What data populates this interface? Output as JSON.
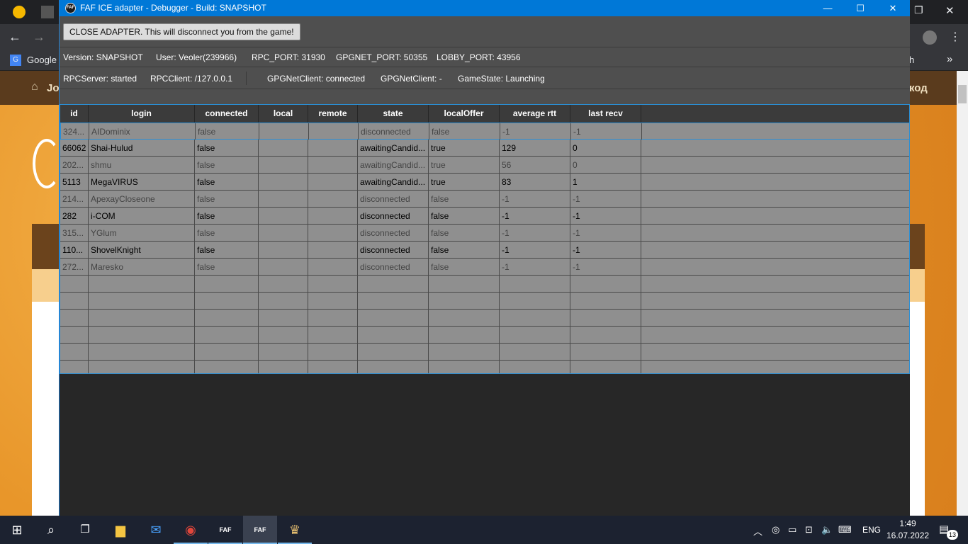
{
  "window": {
    "title": "FAF ICE adapter - Debugger - Build: SNAPSHOT",
    "app_icon_text": "FAF",
    "minimize_glyph": "—",
    "maximize_glyph": "☐",
    "close_glyph": "✕"
  },
  "toolbar": {
    "close_adapter_label": "CLOSE ADAPTER. This will disconnect you from the game!"
  },
  "info": {
    "version": "Version: SNAPSHOT",
    "user": "User: Veoler(239966)",
    "rpc_port": "RPC_PORT: 31930",
    "gpgnet_port": "GPGNET_PORT: 50355",
    "lobby_port": "LOBBY_PORT: 43956"
  },
  "status": {
    "rpc_server": "RPCServer: started",
    "rpc_client": "RPCClient: /127.0.0.1",
    "gpgnet_client": "GPGNetClient: connected",
    "gpgnet_client2": "GPGNetClient: -",
    "game_state": "GameState: Launching"
  },
  "table": {
    "columns": [
      "id",
      "login",
      "connected",
      "local",
      "remote",
      "state",
      "localOffer",
      "average rtt",
      "last recv"
    ],
    "rows": [
      {
        "id": "324...",
        "login": "AIDominix",
        "connected": "false",
        "local": "",
        "remote": "",
        "state": "disconnected",
        "localOffer": "false",
        "rtt": "-1",
        "recv": "-1"
      },
      {
        "id": "66062",
        "login": "Shai-Hulud",
        "connected": "false",
        "local": "",
        "remote": "",
        "state": "awaitingCandid...",
        "localOffer": "true",
        "rtt": "129",
        "recv": "0"
      },
      {
        "id": "202...",
        "login": "shmu",
        "connected": "false",
        "local": "",
        "remote": "",
        "state": "awaitingCandid...",
        "localOffer": "true",
        "rtt": "56",
        "recv": "0"
      },
      {
        "id": "5113",
        "login": "MegaVIRUS",
        "connected": "false",
        "local": "",
        "remote": "",
        "state": "awaitingCandid...",
        "localOffer": "true",
        "rtt": "83",
        "recv": "1"
      },
      {
        "id": "214...",
        "login": "ApexayCloseone",
        "connected": "false",
        "local": "",
        "remote": "",
        "state": "disconnected",
        "localOffer": "false",
        "rtt": "-1",
        "recv": "-1"
      },
      {
        "id": "282",
        "login": "i-COM",
        "connected": "false",
        "local": "",
        "remote": "",
        "state": "disconnected",
        "localOffer": "false",
        "rtt": "-1",
        "recv": "-1"
      },
      {
        "id": "315...",
        "login": "YGlum",
        "connected": "false",
        "local": "",
        "remote": "",
        "state": "disconnected",
        "localOffer": "false",
        "rtt": "-1",
        "recv": "-1"
      },
      {
        "id": "110...",
        "login": "ShovelKnight",
        "connected": "false",
        "local": "",
        "remote": "",
        "state": "disconnected",
        "localOffer": "false",
        "rtt": "-1",
        "recv": "-1"
      },
      {
        "id": "272...",
        "login": "Maresko",
        "connected": "false",
        "local": "",
        "remote": "",
        "state": "disconnected",
        "localOffer": "false",
        "rtt": "-1",
        "recv": "-1"
      }
    ]
  },
  "background": {
    "bookmark_text": "Google I",
    "site_nav_left": "Jo",
    "site_nav_right": "код",
    "bookmark_right": "h"
  },
  "taskbar": {
    "start_icon": "⊞",
    "search_icon": "⌕",
    "taskview_icon": "❐",
    "explorer_icon": "▆",
    "mail_icon": "✉",
    "chrome_icon": "◉",
    "faf1_icon": "FAF",
    "faf2_icon": "FAF",
    "game_icon": "♛",
    "language": "ENG",
    "time": "1:49",
    "date": "16.07.2022",
    "notification_count": "13"
  },
  "colors": {
    "titlebar": "#0078d7",
    "window_bg": "#272727",
    "panel_bg": "#4f4f4f",
    "table_row": "#8f8f8f",
    "table_header": "#3b3b3b",
    "accent_border": "#2a8fd6"
  }
}
